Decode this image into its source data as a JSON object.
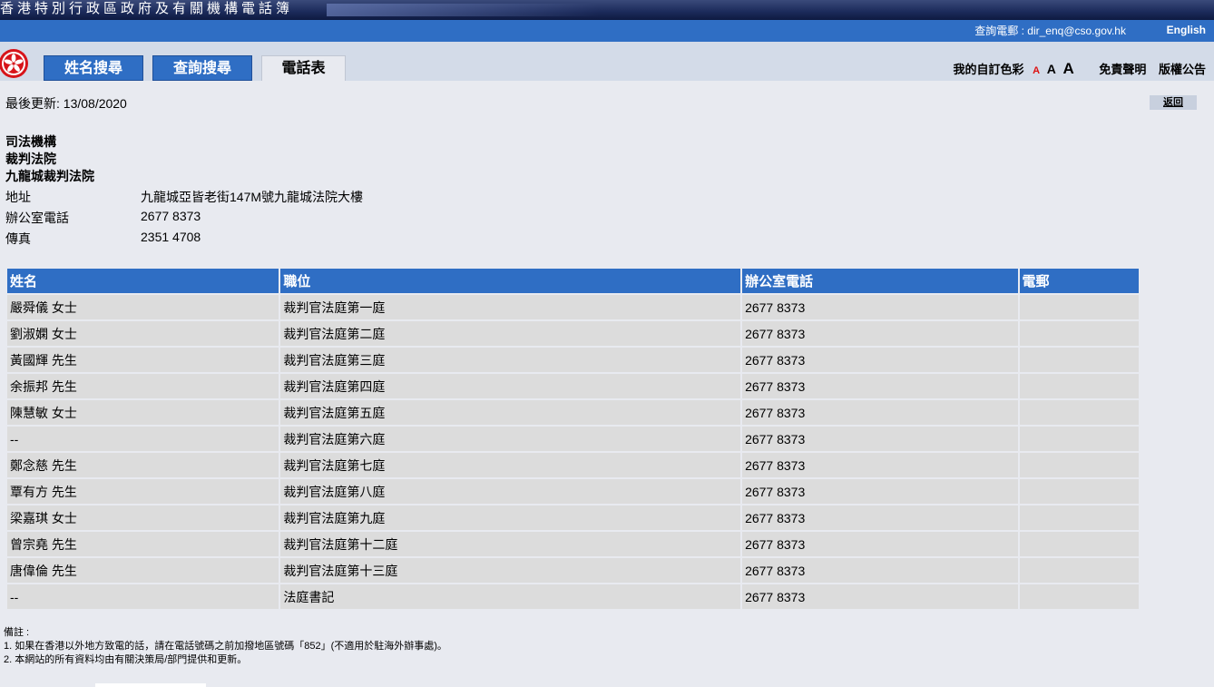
{
  "header": {
    "site_title": "香港特別行政區政府及有關機構電話簿",
    "enquiry": "查詢電郵 : dir_enq@cso.gov.hk",
    "language_link": "English"
  },
  "tabs": [
    {
      "label": "姓名搜尋",
      "active": false
    },
    {
      "label": "查詢搜尋",
      "active": false
    },
    {
      "label": "電話表",
      "active": true
    }
  ],
  "toolbar": {
    "custom_color": "我的自訂色彩",
    "font_small": "A",
    "font_medium": "A",
    "font_large": "A",
    "disclaimer": "免責聲明",
    "copyright": "版權公告"
  },
  "last_updated": "最後更新: 13/08/2020",
  "back_label": "返回",
  "organization": {
    "level1": "司法機構",
    "level2": "裁判法院",
    "level3": "九龍城裁判法院"
  },
  "info": {
    "address_label": "地址",
    "address_value": "九龍城亞皆老街147M號九龍城法院大樓",
    "phone_label": "辦公室電話",
    "phone_value": "2677 8373",
    "fax_label": "傳真",
    "fax_value": "2351 4708"
  },
  "table": {
    "headers": [
      "姓名",
      "職位",
      "辦公室電話",
      "電郵"
    ],
    "rows": [
      [
        "嚴舜儀 女士",
        "裁判官法庭第一庭",
        "2677 8373",
        ""
      ],
      [
        "劉淑嫻 女士",
        "裁判官法庭第二庭",
        "2677 8373",
        ""
      ],
      [
        "黃國輝 先生",
        "裁判官法庭第三庭",
        "2677 8373",
        ""
      ],
      [
        "余振邦 先生",
        "裁判官法庭第四庭",
        "2677 8373",
        ""
      ],
      [
        "陳慧敏 女士",
        "裁判官法庭第五庭",
        "2677 8373",
        ""
      ],
      [
        "--",
        "裁判官法庭第六庭",
        "2677 8373",
        ""
      ],
      [
        "鄭念慈 先生",
        "裁判官法庭第七庭",
        "2677 8373",
        ""
      ],
      [
        "覃有方 先生",
        "裁判官法庭第八庭",
        "2677 8373",
        ""
      ],
      [
        "梁嘉琪 女士",
        "裁判官法庭第九庭",
        "2677 8373",
        ""
      ],
      [
        "曾宗堯 先生",
        "裁判官法庭第十二庭",
        "2677 8373",
        ""
      ],
      [
        "唐偉倫 先生",
        "裁判官法庭第十三庭",
        "2677 8373",
        ""
      ],
      [
        "--",
        "法庭書記",
        "2677 8373",
        ""
      ]
    ]
  },
  "notes": {
    "title": "備註 :",
    "items": [
      "1.  如果在香港以外地方致電的話，請在電話號碼之前加撥地區號碼「852」(不適用於駐海外辦事處)。",
      "2.  本網站的所有資料均由有關決策局/部門提供和更新。"
    ]
  },
  "colors": {
    "accent_blue": "#2f6ec4",
    "banner_navy": "#1b2a5a",
    "emblem_red": "#d7141a"
  },
  "icons": {
    "emblem": "hksar-bauhinia-emblem-icon"
  }
}
